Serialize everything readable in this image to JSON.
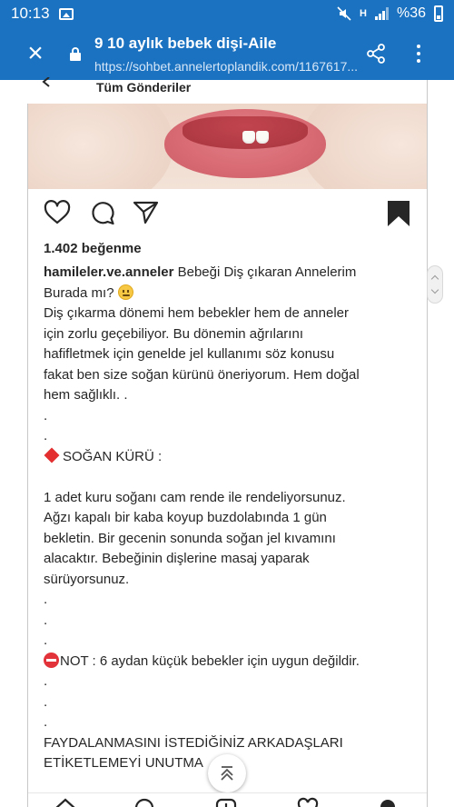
{
  "status_bar": {
    "time": "10:13",
    "network": "H",
    "battery": "%36"
  },
  "browser": {
    "title": "9 10 aylık bebek dişi-Aile",
    "url": "https://sohbet.annelertoplandik.com/1167617...",
    "close_label": "×"
  },
  "instagram": {
    "header_title": "Tüm Gönderiler",
    "likes": "1.402 beğenme",
    "post": {
      "username": "hamileler.ve.anneler",
      "first_line": "Bebeği Diş çıkaran Annelerim",
      "second_line": "Burada mı?",
      "body_lines": [
        "Diş çıkarma dönemi hem bebekler hem de anneler",
        "için zorlu geçebiliyor. Bu dönemin ağrılarını",
        "hafifletmek için genelde jel kullanımı söz konusu",
        "fakat ben size soğan kürünü öneriyorum. Hem doğal",
        "hem sağlıklı. .",
        ".",
        "."
      ],
      "section_title": "SOĞAN KÜRÜ :",
      "recipe_lines": [
        "1 adet kuru soğanı cam rende ile rendeliyorsunuz.",
        "Ağzı kapalı bir kaba koyup buzdolabında 1 gün",
        "bekletin. Bir gecenin sonunda soğan jel kıvamını",
        "alacaktır. Bebeğinin dişlerine masaj yaparak",
        "sürüyorsunuz.",
        ".",
        ".",
        "."
      ],
      "note_text": "NOT : 6 aydan küçük bebekler için uygun değildir.",
      "dots_after_note": [
        ".",
        ".",
        "."
      ],
      "closing_lines": [
        "FAYDALANMASINI İSTEDİĞİNİZ ARKADAŞLARI",
        "ETİKETLEMEYİ UNUTMA"
      ]
    }
  },
  "colors": {
    "browser_bar": "#1b72c0",
    "text": "#262626",
    "accent_diamond": "#e32f2f"
  },
  "icons": {
    "actions": [
      "heart-icon",
      "comment-icon",
      "send-icon",
      "bookmark-icon"
    ],
    "bottom_nav": [
      "home-icon",
      "search-icon",
      "add-post-icon",
      "activity-heart-icon",
      "profile-icon"
    ]
  }
}
